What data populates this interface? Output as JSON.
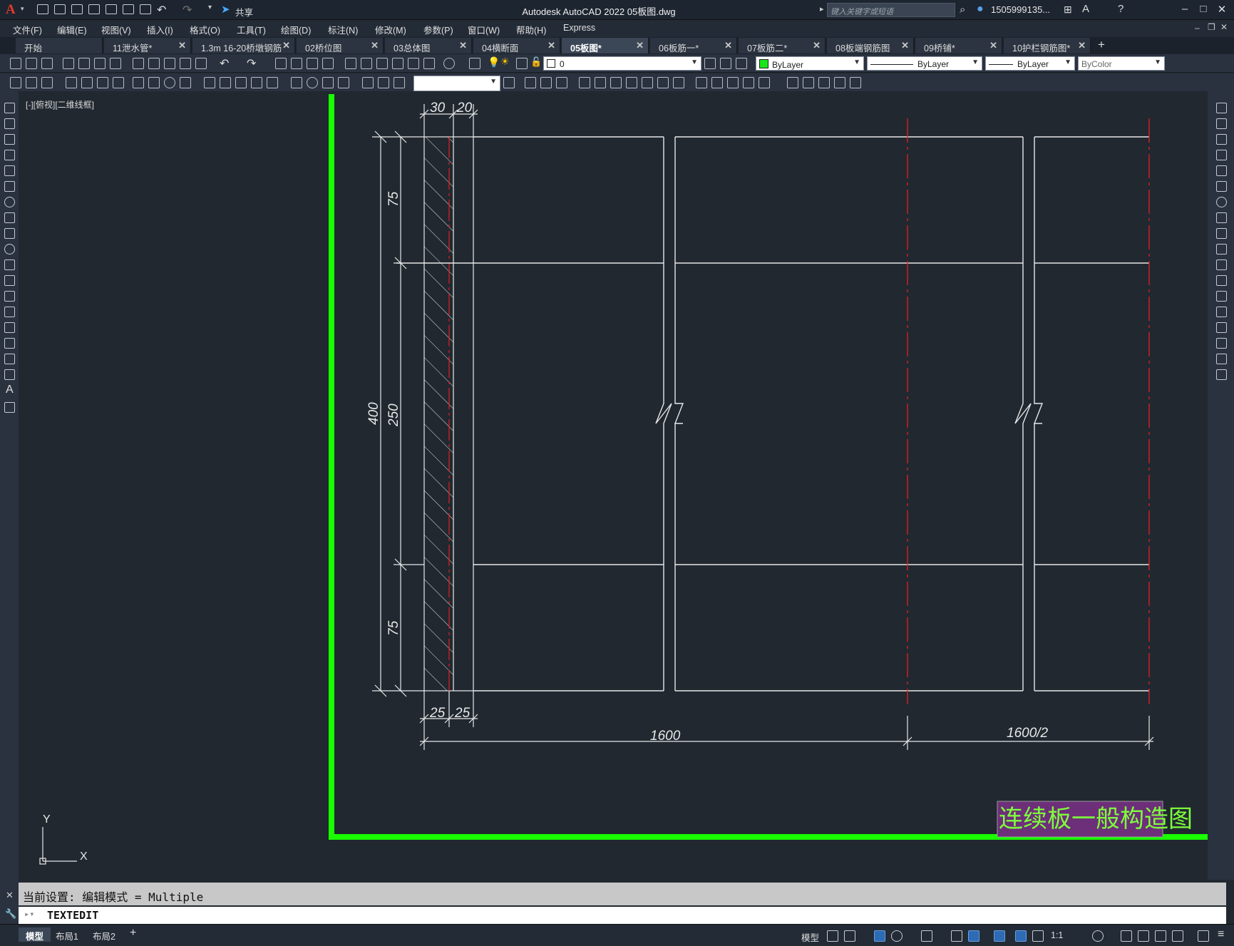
{
  "app": {
    "title": "Autodesk AutoCAD 2022    05板图.dwg",
    "logo": "A",
    "share_label": "共享",
    "search_placeholder": "键入关键字或短语",
    "user": "1505999135..."
  },
  "menu": [
    "文件(F)",
    "编辑(E)",
    "视图(V)",
    "插入(I)",
    "格式(O)",
    "工具(T)",
    "绘图(D)",
    "标注(N)",
    "修改(M)",
    "参数(P)",
    "窗口(W)",
    "帮助(H)",
    "Express"
  ],
  "tabs": [
    {
      "label": "开始",
      "active": false
    },
    {
      "label": "11泄水管*",
      "active": false
    },
    {
      "label": "1.3m 16-20桥墩钢筋",
      "active": false
    },
    {
      "label": "02桥位图",
      "active": false
    },
    {
      "label": "03总体图",
      "active": false
    },
    {
      "label": "04横断面",
      "active": false
    },
    {
      "label": "05板图*",
      "active": true
    },
    {
      "label": "06板筋一*",
      "active": false
    },
    {
      "label": "07板筋二*",
      "active": false
    },
    {
      "label": "08板端钢筋图",
      "active": false
    },
    {
      "label": "09桥铺*",
      "active": false
    },
    {
      "label": "10护栏钢筋图*",
      "active": false
    }
  ],
  "properties": {
    "layer": "0",
    "color": "ByLayer",
    "linetype": "ByLayer",
    "lineweight": "ByLayer",
    "plotstyle": "ByColor",
    "color_swatch": "#19e619"
  },
  "viewport_label": "[-][俯视][二维线框]",
  "drawing": {
    "dim_top_left": "30",
    "dim_top_right": "20",
    "dim_total_height": "400",
    "dim_upper": "75",
    "dim_middle": "250",
    "dim_lower": "75",
    "dim_bottom_left": "25",
    "dim_bottom_right": "25",
    "dim_span": "1600",
    "dim_half_span": "1600/2",
    "title_block_text": "连续板一般构造图",
    "border_color": "#19ff00",
    "centerline_color": "#e02020",
    "title_block_bg": "#6d2e7a",
    "title_block_text_color": "#7dff3a"
  },
  "ucs": {
    "x_label": "X",
    "y_label": "Y"
  },
  "command": {
    "history": "当前设置: 编辑模式 = Multiple",
    "current": "TEXTEDIT"
  },
  "status": {
    "tabs": [
      {
        "label": "模型",
        "active": true
      },
      {
        "label": "布局1",
        "active": false
      },
      {
        "label": "布局2",
        "active": false
      }
    ],
    "model_label": "模型",
    "scale": "1:1"
  }
}
